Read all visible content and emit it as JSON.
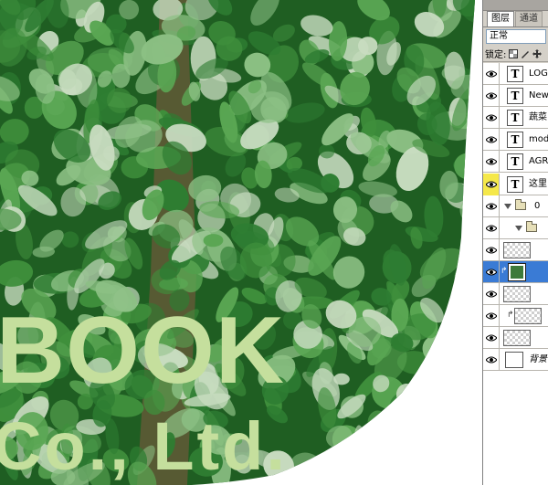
{
  "canvas": {
    "big_text_line1": "BOOK",
    "big_text_line2": "Co., Ltd.",
    "text_color": "#c5df9d",
    "foliage_colors": [
      "#1f5e22",
      "#2e7d32",
      "#3f8f3c",
      "#5aa653",
      "#8cc084",
      "#c8dcc0"
    ]
  },
  "layers_panel": {
    "tabs": [
      {
        "label": "图层",
        "active": true
      },
      {
        "label": "通道",
        "active": false
      }
    ],
    "blend_mode": "正常",
    "lock_label": "锁定:",
    "lock_icons": [
      "lock-transparency-icon",
      "lock-image-icon",
      "lock-position-icon"
    ],
    "layers": [
      {
        "kind": "type",
        "thumb": "T",
        "name": "LOGO",
        "visible": true
      },
      {
        "kind": "type",
        "thumb": "T",
        "name": "New",
        "visible": true
      },
      {
        "kind": "type",
        "thumb": "T",
        "name": "蔬菜",
        "visible": true
      },
      {
        "kind": "type",
        "thumb": "T",
        "name": "mode",
        "visible": true
      },
      {
        "kind": "type",
        "thumb": "T",
        "name": "AGRI",
        "visible": true
      },
      {
        "kind": "type",
        "thumb": "T",
        "name": "这里",
        "visible": true,
        "eye_highlight": true
      },
      {
        "kind": "group",
        "name": "0",
        "visible": true,
        "expanded": true
      },
      {
        "kind": "group",
        "name": "",
        "visible": true,
        "expanded": true,
        "indent": 1
      },
      {
        "kind": "pixel",
        "name": "",
        "visible": true
      },
      {
        "kind": "pixel-image",
        "name": "",
        "visible": true,
        "selected": true,
        "clipped": true
      },
      {
        "kind": "pixel",
        "name": "",
        "visible": true
      },
      {
        "kind": "pixel",
        "name": "",
        "visible": true,
        "clipped": true
      },
      {
        "kind": "pixel",
        "name": "",
        "visible": true
      },
      {
        "kind": "background",
        "name": "背景",
        "visible": true
      }
    ]
  }
}
